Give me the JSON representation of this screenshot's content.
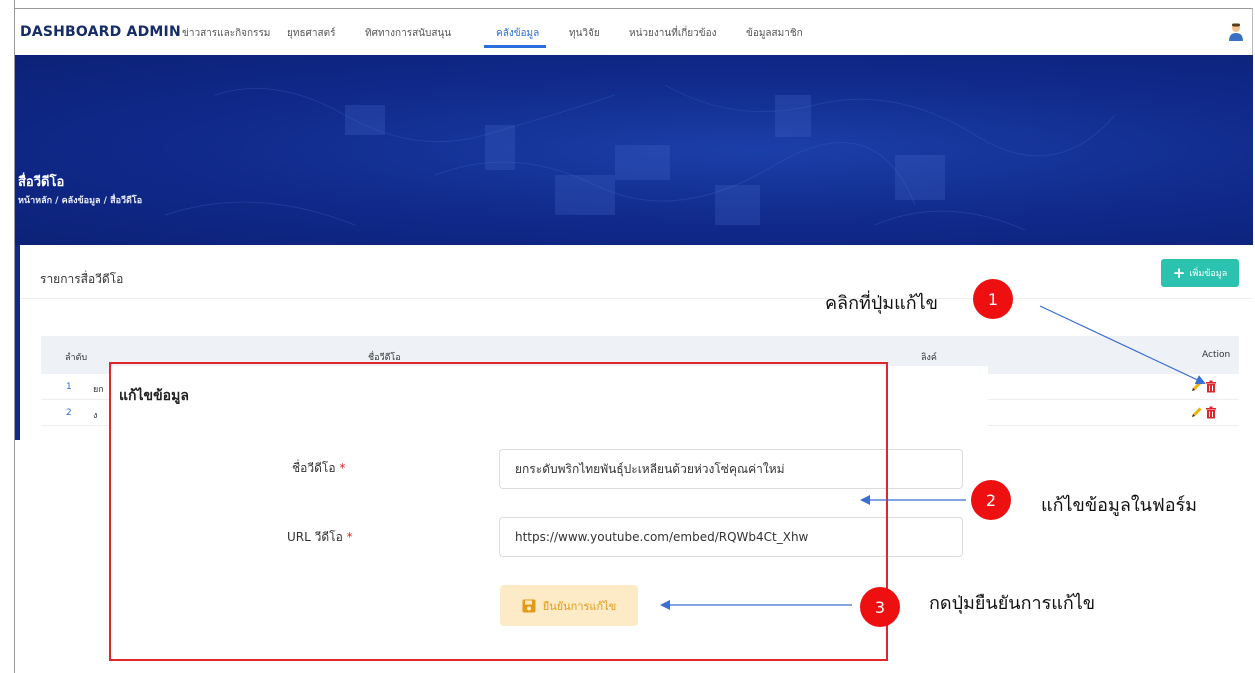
{
  "navbar": {
    "brand": "DASHBOARD ADMIN",
    "items": [
      {
        "label": "ข่าวสารและกิจกรรม"
      },
      {
        "label": "ยุทธศาสตร์"
      },
      {
        "label": "ทิศทางการสนับสนุน"
      },
      {
        "label": "คลังข้อมูล",
        "active": true
      },
      {
        "label": "ทุนวิจัย"
      },
      {
        "label": "หน่วยงานที่เกี่ยวข้อง"
      },
      {
        "label": "ข้อมูลสมาชิก"
      }
    ],
    "avatar_icon": "user-avatar-icon"
  },
  "hero": {
    "title": "สื่อวีดีโอ",
    "breadcrumb": "หน้าหลัก / คลังข้อมูล / สื่อวีดีโอ"
  },
  "card": {
    "title": "รายการสื่อวีดีโอ",
    "add_button": "เพิ่มข้อมูล",
    "add_icon": "plus-icon",
    "columns": [
      "ลำดับ",
      "ชื่อวีดีโอ",
      "ลิงค์",
      "Action"
    ],
    "rows": [
      {
        "num": "1",
        "name": "ยก"
      },
      {
        "num": "2",
        "name": "ง"
      }
    ]
  },
  "modal": {
    "title": "แก้ไขข้อมูล",
    "fields": [
      {
        "label": "ชื่อวีดีโอ",
        "required": "*",
        "value": "ยกระดับพริกไทยพันธุ์ปะเหลียนด้วยห่วงโซ่คุณค่าใหม่"
      },
      {
        "label": "URL วีดีโอ",
        "required": "*",
        "value": "https://www.youtube.com/embed/RQWb4Ct_Xhw"
      }
    ],
    "confirm_button": "ยืนยันการแก้ไข",
    "confirm_icon": "save-icon"
  },
  "annotations": [
    {
      "number": "1",
      "text": "คลิกที่ปุ่มแก้ไข"
    },
    {
      "number": "2",
      "text": "แก้ไขข้อมูลในฟอร์ม"
    },
    {
      "number": "3",
      "text": "กดปุ่มยืนยันการแก้ไข"
    }
  ],
  "colors": {
    "brand": "#152c66",
    "hero": "#10298a",
    "active_nav": "#2a6edb",
    "add_button": "#2bc3b0",
    "highlight": "#e0262a",
    "badge": "#ee1010",
    "confirm_bg": "#fdebc8",
    "confirm_text": "#e39a16"
  }
}
